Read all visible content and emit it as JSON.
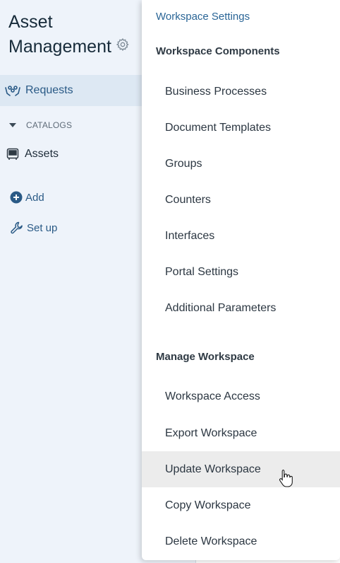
{
  "sidebar": {
    "workspace_title_line1": "Asset",
    "workspace_title_line2": "Management",
    "requests_label": "Requests",
    "catalogs_label": "CATALOGS",
    "assets_label": "Assets",
    "add_label": "Add",
    "setup_label": "Set up"
  },
  "menu": {
    "settings_link": "Workspace Settings",
    "components_heading": "Workspace Components",
    "components": [
      "Business Processes",
      "Document Templates",
      "Groups",
      "Counters",
      "Interfaces",
      "Portal Settings",
      "Additional Parameters"
    ],
    "manage_heading": "Manage Workspace",
    "manage": [
      "Workspace Access",
      "Export Workspace",
      "Update Workspace",
      "Copy Workspace",
      "Delete Workspace"
    ]
  },
  "colors": {
    "accent": "#2a6596",
    "sidebar_bg": "#eef3fa",
    "active_bg": "#dde8f3",
    "hover_bg": "#ececec"
  },
  "icons": [
    "gear-icon",
    "requests-icon",
    "caret-down-icon",
    "assets-icon",
    "add-icon",
    "wrench-icon",
    "hand-cursor-icon"
  ]
}
